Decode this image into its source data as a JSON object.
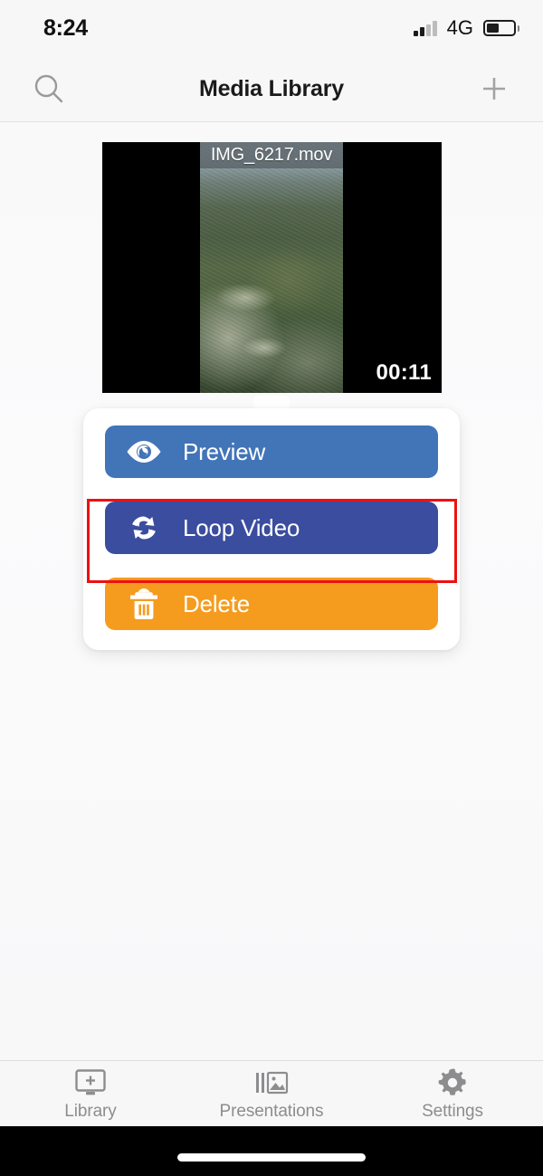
{
  "status_bar": {
    "time": "8:24",
    "network": "4G",
    "signal_icon": "signal-bars-icon",
    "signal_bars_filled": 2,
    "signal_bars_total": 4,
    "battery_icon": "battery-icon",
    "battery_percent": 45
  },
  "nav_bar": {
    "title": "Media Library",
    "search_icon": "search-icon",
    "add_icon": "plus-icon"
  },
  "media": {
    "filename": "IMG_6217.mov",
    "duration": "00:11",
    "thumbnail_description": "aerial-forest-mountain-video-frame"
  },
  "popover": {
    "items": [
      {
        "label": "Preview",
        "icon": "eye-icon",
        "color": "#4274b8",
        "highlighted": false
      },
      {
        "label": "Loop Video",
        "icon": "loop-icon",
        "color": "#3a4d9e",
        "highlighted": true
      },
      {
        "label": "Delete",
        "icon": "trash-icon",
        "color": "#f59c1f",
        "highlighted": false
      }
    ],
    "highlight_color": "#ee1111"
  },
  "tab_bar": {
    "items": [
      {
        "label": "Library",
        "icon": "monitor-plus-icon"
      },
      {
        "label": "Presentations",
        "icon": "slides-image-icon"
      },
      {
        "label": "Settings",
        "icon": "gear-icon"
      }
    ]
  },
  "colors": {
    "page_background": "#f7f7f8",
    "accent_preview": "#4274b8",
    "accent_loop": "#3a4d9e",
    "accent_delete": "#f59c1f",
    "highlight": "#ee1111",
    "tab_inactive": "#8d8d8f"
  }
}
